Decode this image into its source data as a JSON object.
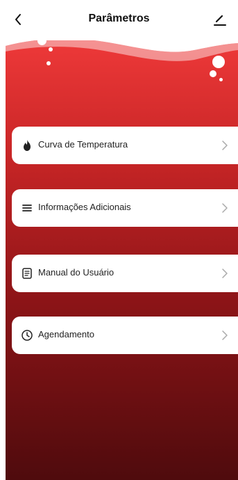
{
  "header": {
    "title": "Parâmetros",
    "back_icon": "chevron-left-icon",
    "edit_icon": "pencil-icon"
  },
  "menu": [
    {
      "label": "Curva de Temperatura",
      "icon": "flame-icon"
    },
    {
      "label": "Informações Adicionais",
      "icon": "list-icon"
    },
    {
      "label": "Manual do Usuário",
      "icon": "document-icon"
    },
    {
      "label": "Agendamento",
      "icon": "clock-icon"
    }
  ],
  "colors": {
    "accent_top": "#f03a3a",
    "accent_bottom": "#4f0b0d",
    "card": "#ffffff"
  }
}
